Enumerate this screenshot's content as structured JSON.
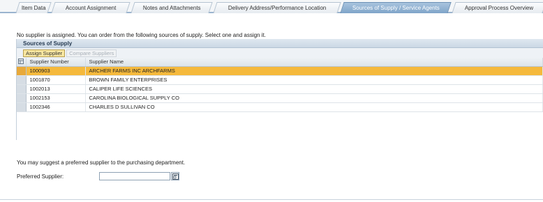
{
  "tabs": [
    {
      "label": "Item Data"
    },
    {
      "label": "Account Assignment"
    },
    {
      "label": "Notes and Attachments"
    },
    {
      "label": "Delivery Address/Performance Location"
    },
    {
      "label": "Sources of Supply / Service Agents",
      "active": true
    },
    {
      "label": "Approval Process Overview"
    }
  ],
  "message": "No supplier is assigned. You can order from the following sources of supply. Select one and assign it.",
  "sources": {
    "title": "Sources of Supply",
    "assign_label": "Assign Supplier",
    "compare_label": "Compare Suppliers",
    "columns": {
      "number": "Supplier Number",
      "name": "Supplier Name"
    },
    "rows": [
      {
        "number": "1000903",
        "name": "ARCHER FARMS INC ARCHFARMS",
        "selected": true
      },
      {
        "number": "1001870",
        "name": "BROWN FAMILY ENTERPRISES"
      },
      {
        "number": "1002013",
        "name": "CALIPER LIFE SCIENCES"
      },
      {
        "number": "1002153",
        "name": "CAROLINA BIOLOGICAL SUPPLY CO"
      },
      {
        "number": "1002346",
        "name": "CHARLES D SULLIVAN CO"
      }
    ]
  },
  "suggestion": {
    "text": "You may suggest a preferred supplier to the purchasing department.",
    "label": "Preferred Supplier:",
    "value": ""
  },
  "colors": {
    "selected_row": "#f5b93c",
    "active_tab": "#7fa4c9"
  }
}
